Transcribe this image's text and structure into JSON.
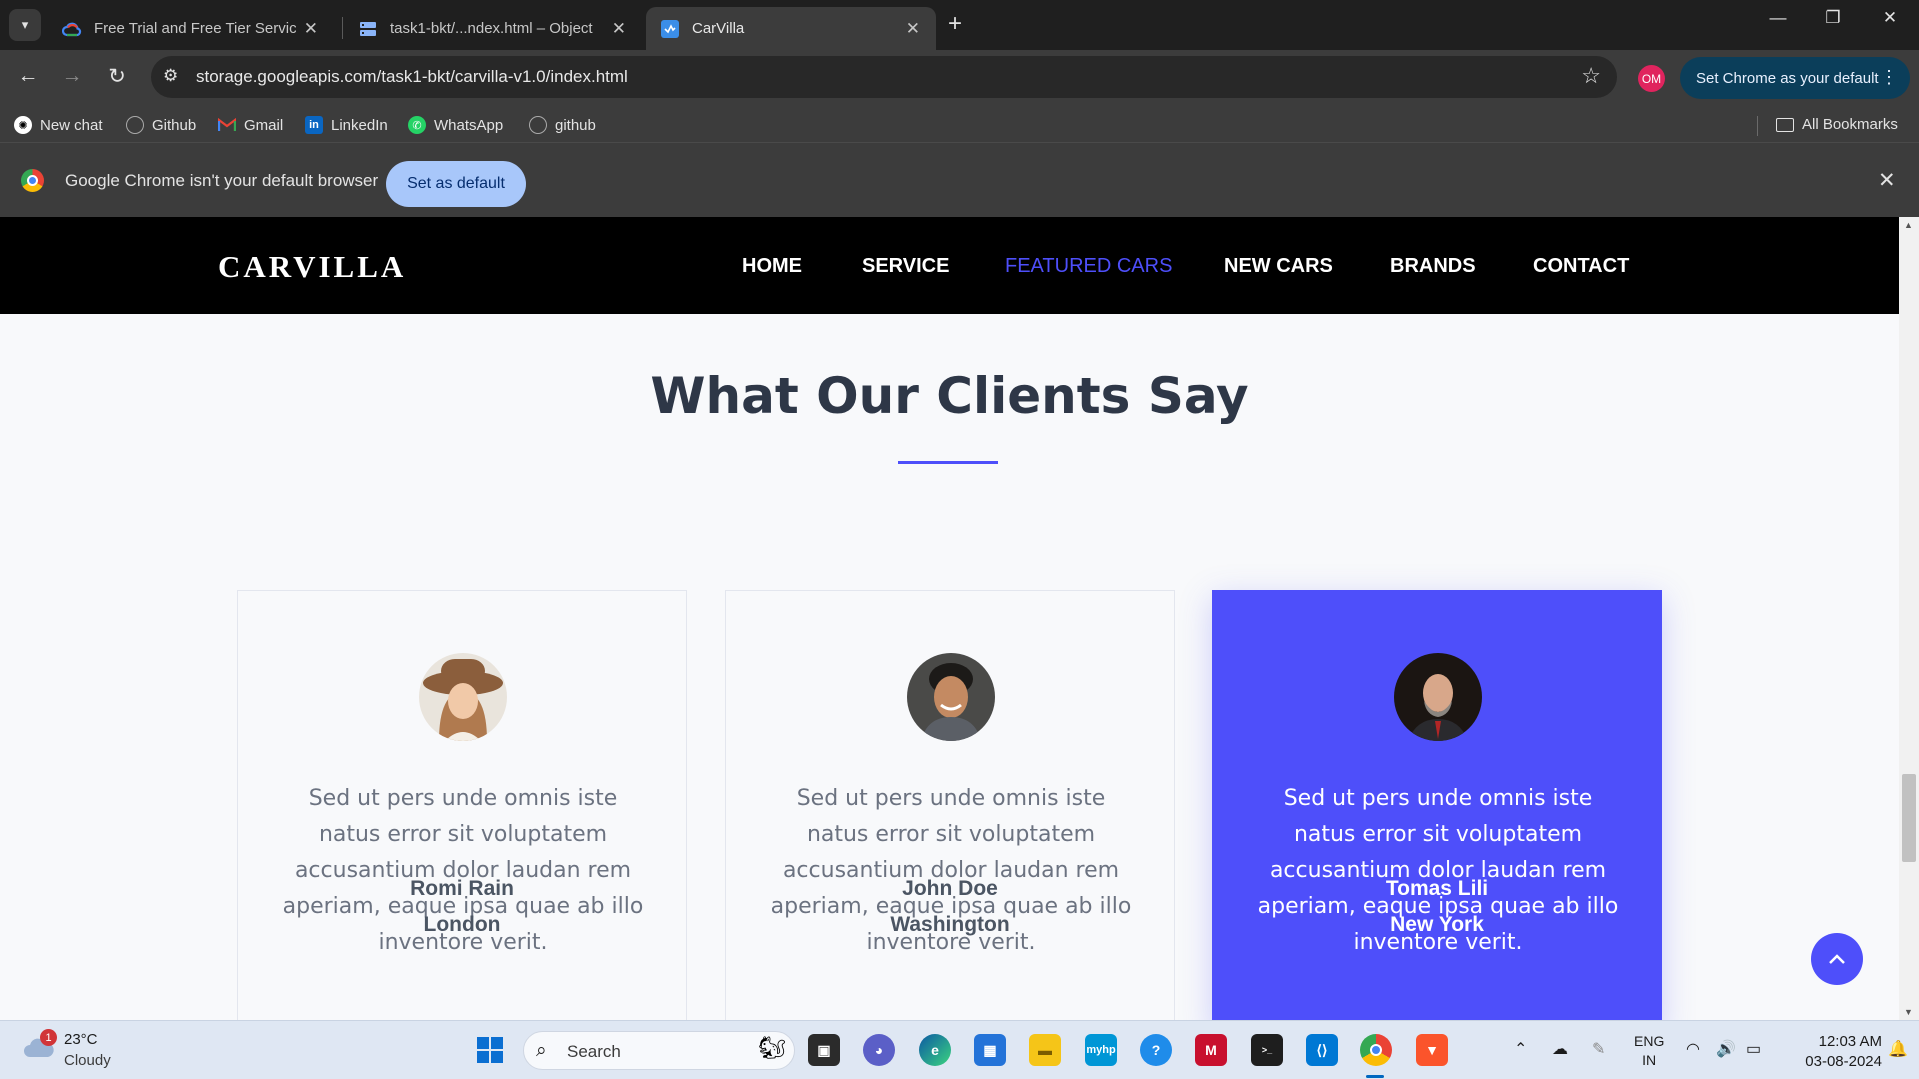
{
  "browser": {
    "tabs": [
      {
        "title": "Free Trial and Free Tier Services",
        "favicon": "google-cloud-icon"
      },
      {
        "title": "task1-bkt/...ndex.html – Object",
        "favicon": "storage-bucket-icon"
      },
      {
        "title": "CarVilla",
        "favicon": "carvilla-icon",
        "active": true
      }
    ],
    "url": "storage.googleapis.com/task1-bkt/carvilla-v1.0/index.html",
    "profile_initials": "OM",
    "default_chip": "Set Chrome as your default",
    "bookmarks": [
      {
        "label": "New chat",
        "icon": "openai-icon"
      },
      {
        "label": "Github",
        "icon": "github-icon"
      },
      {
        "label": "Gmail",
        "icon": "gmail-icon"
      },
      {
        "label": "LinkedIn",
        "icon": "linkedin-icon"
      },
      {
        "label": "WhatsApp",
        "icon": "whatsapp-icon"
      },
      {
        "label": "github",
        "icon": "github-icon"
      }
    ],
    "all_bookmarks": "All Bookmarks",
    "infobar": {
      "message": "Google Chrome isn't your default browser",
      "button": "Set as default"
    }
  },
  "site": {
    "logo": "CARVILLA",
    "menu": [
      {
        "label": "HOME"
      },
      {
        "label": "SERVICE"
      },
      {
        "label": "FEATURED CARS",
        "active": true
      },
      {
        "label": "NEW CARS"
      },
      {
        "label": "BRANDS"
      },
      {
        "label": "CONTACT"
      }
    ],
    "section_title": "What Our Clients Say",
    "testimonials": [
      {
        "quote": "Sed ut pers unde omnis iste natus error sit voluptatem accusantium dolor laudan rem aperiam, eaque ipsa quae ab illo inventore verit.",
        "name": "Romi Rain",
        "city": "London"
      },
      {
        "quote": "Sed ut pers unde omnis iste natus error sit voluptatem accusantium dolor laudan rem aperiam, eaque ipsa quae ab illo inventore verit.",
        "name": "John Doe",
        "city": "Washington"
      },
      {
        "quote": "Sed ut pers unde omnis iste natus error sit voluptatem accusantium dolor laudan rem aperiam, eaque ipsa quae ab illo inventore verit.",
        "name": "Tomas Lili",
        "city": "New York",
        "highlighted": true
      }
    ],
    "colors": {
      "accent": "#4e4ffa",
      "nav_bg": "#000000",
      "page_bg": "#f8f9fb",
      "heading": "#2e3747"
    }
  },
  "taskbar": {
    "weather": {
      "temp": "23°C",
      "desc": "Cloudy",
      "badge": "1"
    },
    "search_placeholder": "Search",
    "apps": [
      "windows-start-icon",
      "task-view-icon",
      "teams-chat-icon",
      "edge-icon",
      "microsoft-store-icon",
      "file-explorer-icon",
      "myhp-icon",
      "help-icon",
      "mcafee-icon",
      "terminal-icon",
      "vscode-icon",
      "chrome-icon",
      "brave-icon"
    ],
    "lang_line1": "ENG",
    "lang_line2": "IN",
    "time": "12:03 AM",
    "date": "03-08-2024"
  }
}
